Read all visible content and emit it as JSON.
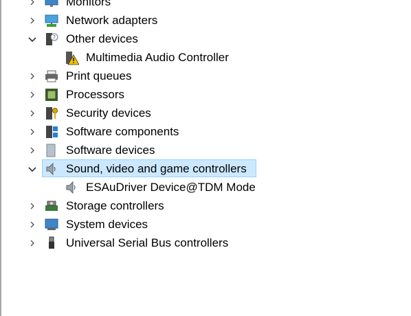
{
  "tree": {
    "items": [
      {
        "label": "Monitors",
        "expanded": false,
        "icon": "monitor-icon"
      },
      {
        "label": "Network adapters",
        "expanded": false,
        "icon": "network-adapter-icon"
      },
      {
        "label": "Other devices",
        "expanded": true,
        "icon": "unknown-device-icon"
      },
      {
        "label": "Multimedia Audio Controller",
        "child": true,
        "icon": "warning-device-icon"
      },
      {
        "label": "Print queues",
        "expanded": false,
        "icon": "printer-icon"
      },
      {
        "label": "Processors",
        "expanded": false,
        "icon": "processor-icon"
      },
      {
        "label": "Security devices",
        "expanded": false,
        "icon": "security-device-icon"
      },
      {
        "label": "Software components",
        "expanded": false,
        "icon": "software-component-icon"
      },
      {
        "label": "Software devices",
        "expanded": false,
        "icon": "software-device-icon"
      },
      {
        "label": "Sound, video and game controllers",
        "expanded": true,
        "selected": true,
        "icon": "speaker-icon"
      },
      {
        "label": "ESAuDriver Device@TDM Mode",
        "child": true,
        "icon": "speaker-icon"
      },
      {
        "label": "Storage controllers",
        "expanded": false,
        "icon": "storage-controller-icon"
      },
      {
        "label": "System devices",
        "expanded": false,
        "icon": "system-device-icon"
      },
      {
        "label": "Universal Serial Bus controllers",
        "expanded": false,
        "icon": "usb-icon"
      }
    ]
  },
  "colors": {
    "selection_fill": "#cce8ff",
    "selection_border": "#99d1ff",
    "warning": "#f2c200"
  }
}
